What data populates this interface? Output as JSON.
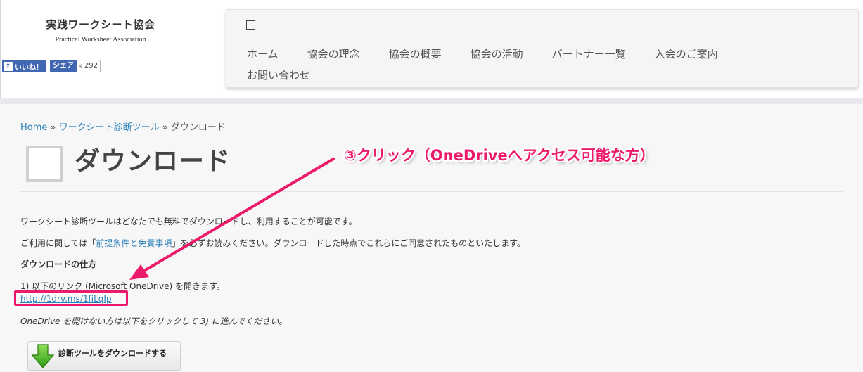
{
  "header": {
    "logo": {
      "jp": "実践ワークシート協会",
      "en": "Practical Worksheet Association"
    },
    "social": {
      "like_label": "いいね！",
      "share_label": "シェア",
      "count": "292",
      "fb_glyph": "f"
    },
    "nav": {
      "menu_icon": "square-icon",
      "items": [
        "ホーム",
        "協会の理念",
        "協会の概要",
        "協会の活動",
        "パートナー一覧",
        "入会のご案内",
        "お問い合わせ"
      ]
    }
  },
  "breadcrumb": {
    "home": "Home",
    "sep1": " » ",
    "parent": "ワークシート診断ツール",
    "sep2": " » ",
    "current": "ダウンロード"
  },
  "page": {
    "title": "ダウンロード",
    "intro": "ワークシート診断ツールはどなたでも無料でダウンロードし、利用することが可能です。",
    "notice_pre": "ご利用に関しては「",
    "notice_link": "前提条件と免責事項",
    "notice_post": "」を必ずお読みください。ダウンロードした時点でこれらにご同意されたものといたします。",
    "how_heading": "ダウンロードの仕方",
    "step1": "1) 以下のリンク (Microsoft OneDrive) を開きます。",
    "onedrive_link": "http://1drv.ms/1fiLqIp",
    "fallback": "OneDrive を開けない方は以下をクリックして 3) に進んでください。",
    "download_button": "診断ツールをダウンロードする"
  },
  "annotation": {
    "text": "③クリック（OneDriveへアクセス可能な方）",
    "color": "#ec1a6a"
  },
  "colors": {
    "link": "#2a7fb8",
    "facebook": "#4267b2",
    "annotation": "#ec1a6a"
  }
}
